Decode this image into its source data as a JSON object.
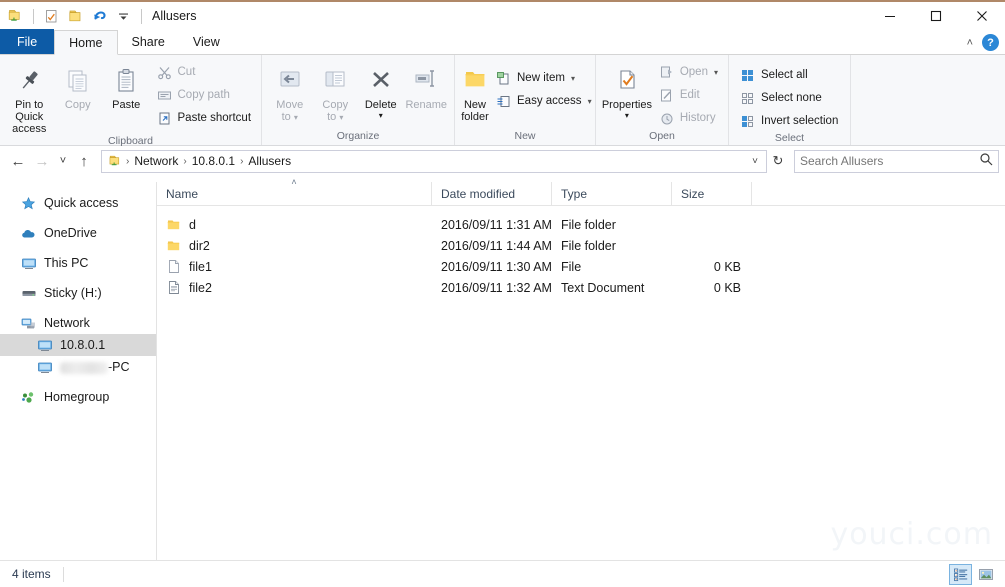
{
  "window": {
    "title": "Allusers",
    "accent_top_color": "#b08868",
    "controls": {
      "minimize": "—",
      "maximize": "□",
      "close": "✕"
    }
  },
  "quick_access_toolbar": {
    "items": [
      {
        "name": "network-folder-icon",
        "label": "Allusers"
      },
      {
        "name": "properties-icon",
        "label": "Properties"
      },
      {
        "name": "new-folder-icon",
        "label": "New folder"
      },
      {
        "name": "undo-icon",
        "label": "Undo"
      },
      {
        "name": "customize-dropdown-icon",
        "label": "Customize Quick Access Toolbar"
      }
    ]
  },
  "tabs": [
    {
      "id": "file",
      "label": "File"
    },
    {
      "id": "home",
      "label": "Home"
    },
    {
      "id": "share",
      "label": "Share"
    },
    {
      "id": "view",
      "label": "View"
    }
  ],
  "active_tab": "home",
  "tabstrip_right": {
    "collapse_label": "˄",
    "help_label": "?"
  },
  "ribbon": {
    "groups": [
      {
        "name": "clipboard",
        "label": "Clipboard",
        "big_buttons": [
          {
            "name": "pin-to-quick-access-button",
            "label_line1": "Pin to Quick",
            "label_line2": "access",
            "disabled": false
          },
          {
            "name": "copy-button",
            "label_line1": "Copy",
            "label_line2": "",
            "disabled": true
          },
          {
            "name": "paste-button",
            "label_line1": "Paste",
            "label_line2": "",
            "disabled": false
          }
        ],
        "small_buttons": [
          {
            "name": "cut-button",
            "label": "Cut",
            "disabled": true
          },
          {
            "name": "copy-path-button",
            "label": "Copy path",
            "disabled": true
          },
          {
            "name": "paste-shortcut-button",
            "label": "Paste shortcut",
            "disabled": false
          }
        ]
      },
      {
        "name": "organize",
        "label": "Organize",
        "big_buttons": [
          {
            "name": "move-to-button",
            "label_line1": "Move",
            "label_line2": "to",
            "disabled": true,
            "caret": true
          },
          {
            "name": "copy-to-button",
            "label_line1": "Copy",
            "label_line2": "to",
            "disabled": true,
            "caret": true
          },
          {
            "name": "delete-button",
            "label_line1": "Delete",
            "label_line2": "",
            "disabled": false,
            "caret": true
          },
          {
            "name": "rename-button",
            "label_line1": "Rename",
            "label_line2": "",
            "disabled": true
          }
        ],
        "small_buttons": []
      },
      {
        "name": "new",
        "label": "New",
        "big_buttons": [
          {
            "name": "new-folder-button",
            "label_line1": "New",
            "label_line2": "folder",
            "disabled": false
          }
        ],
        "small_buttons": [
          {
            "name": "new-item-button",
            "label": "New item",
            "disabled": false,
            "dropdown": true
          },
          {
            "name": "easy-access-button",
            "label": "Easy access",
            "disabled": false,
            "dropdown": true
          }
        ]
      },
      {
        "name": "open",
        "label": "Open",
        "big_buttons": [
          {
            "name": "properties-button",
            "label_line1": "Properties",
            "label_line2": "",
            "disabled": false,
            "caret": true
          }
        ],
        "small_buttons": [
          {
            "name": "open-button",
            "label": "Open",
            "disabled": true,
            "dropdown": true
          },
          {
            "name": "edit-button",
            "label": "Edit",
            "disabled": true
          },
          {
            "name": "history-button",
            "label": "History",
            "disabled": true
          }
        ]
      },
      {
        "name": "select",
        "label": "Select",
        "big_buttons": [],
        "small_buttons": [
          {
            "name": "select-all-button",
            "label": "Select all",
            "disabled": false
          },
          {
            "name": "select-none-button",
            "label": "Select none",
            "disabled": false
          },
          {
            "name": "invert-selection-button",
            "label": "Invert selection",
            "disabled": false
          }
        ]
      }
    ]
  },
  "addressbar": {
    "back_label": "←",
    "forward_label": "→",
    "recent_label": "˅",
    "up_label": "↑",
    "breadcrumbs": [
      "Network",
      "10.8.0.1",
      "Allusers"
    ],
    "separator": "›",
    "dropdown_label": "˅",
    "refresh_label": "↻"
  },
  "search": {
    "placeholder": "Search Allusers",
    "value": "",
    "icon_label": "⌕"
  },
  "navigation_pane": {
    "items": [
      {
        "name": "quick-access",
        "label": "Quick access",
        "icon": "star-icon",
        "child": false,
        "selected": false
      },
      {
        "name": "onedrive",
        "label": "OneDrive",
        "icon": "cloud-icon",
        "child": false,
        "selected": false
      },
      {
        "name": "this-pc",
        "label": "This PC",
        "icon": "monitor-icon",
        "child": false,
        "selected": false
      },
      {
        "name": "sticky-h",
        "label": "Sticky (H:)",
        "icon": "drive-icon",
        "child": false,
        "selected": false
      },
      {
        "name": "network",
        "label": "Network",
        "icon": "network-icon",
        "child": false,
        "selected": false
      },
      {
        "name": "network-10-8-0-1",
        "label": "10.8.0.1",
        "icon": "computer-icon",
        "child": true,
        "selected": true
      },
      {
        "name": "network-pc",
        "label": "-PC",
        "icon": "computer-icon",
        "child": true,
        "selected": false,
        "redacted": true
      },
      {
        "name": "homegroup",
        "label": "Homegroup",
        "icon": "homegroup-icon",
        "child": false,
        "selected": false
      }
    ]
  },
  "file_list": {
    "columns": [
      {
        "key": "name",
        "label": "Name",
        "sorted": true,
        "sort_mark": "˄"
      },
      {
        "key": "date",
        "label": "Date modified",
        "sorted": false
      },
      {
        "key": "type",
        "label": "Type",
        "sorted": false
      },
      {
        "key": "size",
        "label": "Size",
        "sorted": false
      }
    ],
    "rows": [
      {
        "icon": "folder-icon",
        "name": "d",
        "date": "2016/09/11 1:31 AM",
        "type": "File folder",
        "size": ""
      },
      {
        "icon": "folder-icon",
        "name": "dir2",
        "date": "2016/09/11 1:44 AM",
        "type": "File folder",
        "size": ""
      },
      {
        "icon": "file-icon",
        "name": "file1",
        "date": "2016/09/11 1:30 AM",
        "type": "File",
        "size": "0 KB"
      },
      {
        "icon": "text-document-icon",
        "name": "file2",
        "date": "2016/09/11 1:32 AM",
        "type": "Text Document",
        "size": "0 KB"
      }
    ]
  },
  "watermark": {
    "text": "youci.com"
  },
  "statusbar": {
    "item_count": "4 items",
    "view_buttons": [
      {
        "name": "details-view-button",
        "label": "Details view",
        "selected": true
      },
      {
        "name": "large-icons-view-button",
        "label": "Large icons view",
        "selected": false
      }
    ]
  }
}
